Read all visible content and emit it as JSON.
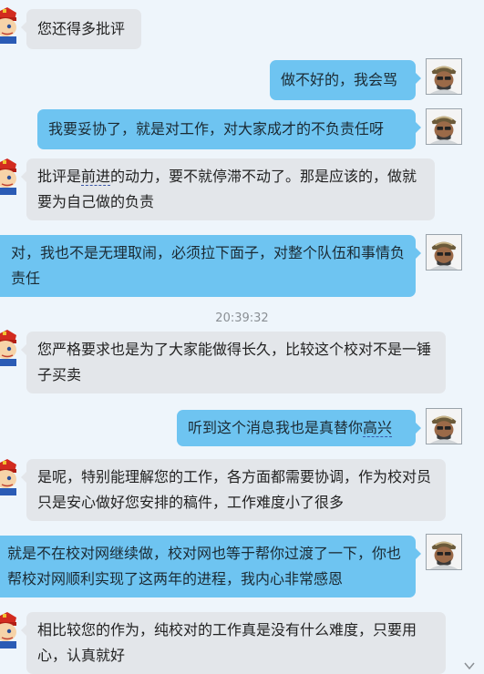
{
  "chat": {
    "timestamp": "20:39:32",
    "messages": [
      {
        "side": "left",
        "text": "您还得多批评"
      },
      {
        "side": "right",
        "text": "做不好的，我会骂"
      },
      {
        "side": "right",
        "text": "我要妥协了，就是对工作，对大家成才的不负责任呀"
      },
      {
        "side": "left",
        "text_before": "批评是",
        "text_underlined": "前进",
        "text_after": "的动力，要不就停滞不动了。那是应该的，做就要为自己做的负责"
      },
      {
        "side": "right",
        "text": "对，我也不是无理取闹，必须拉下面子，对整个队伍和事情负责任"
      },
      {
        "side": "left",
        "text": "您严格要求也是为了大家能做得长久，比较这个校对不是一锤子买卖"
      },
      {
        "side": "right",
        "text_before": "听到这个消息我也是真替你",
        "text_underlined": "高兴"
      },
      {
        "side": "left",
        "text": "是呢，特别能理解您的工作，各方面都需要协调，作为校对员只是安心做好您安排的稿件，工作难度小了很多"
      },
      {
        "side": "right",
        "text": "就是不在校对网继续做，校对网也等于帮你过渡了一下，你也帮校对网顺利实现了这两年的进程，我内心非常感恩"
      },
      {
        "side": "left",
        "text": "相比较您的作为，纯校对的工作真是没有什么难度，只要用心，认真就好"
      }
    ]
  },
  "colors": {
    "background": "#eef5fb",
    "bubble_left": "#e3e6ea",
    "bubble_right": "#6ec4f1"
  },
  "icons": {
    "left_avatar": "cartoon-avatar-icon",
    "right_avatar": "user-photo-icon",
    "scroll": "scroll-down-arrow-icon"
  }
}
